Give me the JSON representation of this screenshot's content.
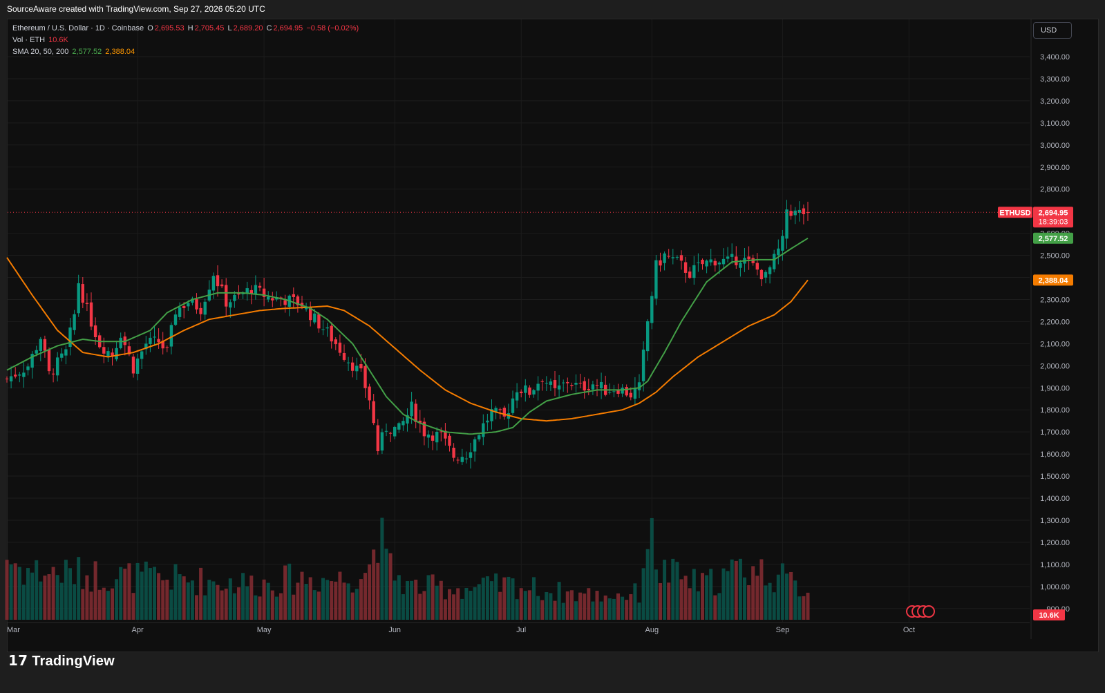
{
  "header": {
    "credit": "SourceAware created with TradingView.com, Sep 27, 2026 05:20 UTC"
  },
  "legend": {
    "symbol": "Ethereum / U.S. Dollar · 1D · Coinbase",
    "o_label": "O",
    "o_value": "2,695.53",
    "h_label": "H",
    "h_value": "2,705.45",
    "l_label": "L",
    "l_value": "2,689.20",
    "c_label": "C",
    "c_value": "2,694.95",
    "change": "−0.58 (−0.02%)",
    "vol_label": "Vol · ETH",
    "vol_value": "10.6K",
    "sma_label": "SMA 20, 50, 200",
    "sma20_value": "2,577.52",
    "sma50_value": "2,388.04"
  },
  "currency_button": "USD",
  "brand": "TradingView",
  "colors": {
    "up": "#089981",
    "down": "#f23645",
    "sma20": "#43a047",
    "sma50": "#f57c00",
    "background": "#0f0f0f",
    "grid": "#1c1c1c",
    "text": "#b2b5be"
  },
  "chart_data": {
    "type": "candlestick",
    "title": "Ethereum / U.S. Dollar · 1D · Coinbase",
    "ylim": [
      900,
      3500
    ],
    "y_ticks": [
      3400,
      3300,
      3200,
      3100,
      3000,
      2900,
      2800,
      2600,
      2500,
      2400,
      2300,
      2200,
      2100,
      2000,
      1900,
      1800,
      1700,
      1600,
      1500,
      1400,
      1300,
      1200,
      1100,
      1000,
      900
    ],
    "y_tick_labels": [
      "3,400.00",
      "3,300.00",
      "3,200.00",
      "3,100.00",
      "3,000.00",
      "2,900.00",
      "2,800.00",
      "2,600.00",
      "2,500.00",
      "2,400.00",
      "2,300.00",
      "2,200.00",
      "2,100.00",
      "2,000.00",
      "1,900.00",
      "1,800.00",
      "1,700.00",
      "1,600.00",
      "1,500.00",
      "1,400.00",
      "1,300.00",
      "1,200.00",
      "1,100.00",
      "1,000.00",
      "900.00"
    ],
    "x_ticks": [
      "Mar",
      "Apr",
      "May",
      "Jun",
      "Jul",
      "Aug",
      "Sep",
      "Oct"
    ],
    "x_tick_days": [
      0,
      31,
      61,
      92,
      122,
      153,
      184,
      214
    ],
    "close_keypoints": [
      [
        0,
        1940
      ],
      [
        5,
        2000
      ],
      [
        8,
        2130
      ],
      [
        10,
        1960
      ],
      [
        14,
        2060
      ],
      [
        16,
        2230
      ],
      [
        17,
        2380
      ],
      [
        19,
        2250
      ],
      [
        22,
        2100
      ],
      [
        25,
        2050
      ],
      [
        27,
        2150
      ],
      [
        30,
        1990
      ],
      [
        33,
        2100
      ],
      [
        36,
        2110
      ],
      [
        38,
        2060
      ],
      [
        40,
        2250
      ],
      [
        43,
        2290
      ],
      [
        46,
        2260
      ],
      [
        49,
        2420
      ],
      [
        52,
        2290
      ],
      [
        55,
        2310
      ],
      [
        58,
        2350
      ],
      [
        62,
        2310
      ],
      [
        66,
        2300
      ],
      [
        70,
        2280
      ],
      [
        73,
        2210
      ],
      [
        76,
        2150
      ],
      [
        80,
        2050
      ],
      [
        84,
        1960
      ],
      [
        86,
        1850
      ],
      [
        88,
        1620
      ],
      [
        90,
        1720
      ],
      [
        93,
        1710
      ],
      [
        96,
        1810
      ],
      [
        99,
        1700
      ],
      [
        103,
        1680
      ],
      [
        106,
        1590
      ],
      [
        109,
        1600
      ],
      [
        112,
        1700
      ],
      [
        115,
        1790
      ],
      [
        118,
        1760
      ],
      [
        121,
        1900
      ],
      [
        124,
        1880
      ],
      [
        127,
        1950
      ],
      [
        130,
        1880
      ],
      [
        133,
        1930
      ],
      [
        136,
        1900
      ],
      [
        139,
        1920
      ],
      [
        142,
        1890
      ],
      [
        145,
        1900
      ],
      [
        148,
        1870
      ],
      [
        150,
        1900
      ],
      [
        152,
        2200
      ],
      [
        154,
        2450
      ],
      [
        156,
        2500
      ],
      [
        159,
        2470
      ],
      [
        162,
        2420
      ],
      [
        165,
        2460
      ],
      [
        168,
        2480
      ],
      [
        171,
        2470
      ],
      [
        174,
        2490
      ],
      [
        177,
        2450
      ],
      [
        180,
        2400
      ],
      [
        182,
        2480
      ],
      [
        184,
        2560
      ],
      [
        185,
        2710
      ],
      [
        187,
        2690
      ],
      [
        190,
        2694.95
      ]
    ],
    "sma20_points": [
      [
        0,
        1980
      ],
      [
        6,
        2040
      ],
      [
        12,
        2090
      ],
      [
        18,
        2120
      ],
      [
        22,
        2110
      ],
      [
        28,
        2110
      ],
      [
        34,
        2160
      ],
      [
        38,
        2240
      ],
      [
        44,
        2300
      ],
      [
        50,
        2330
      ],
      [
        56,
        2330
      ],
      [
        61,
        2320
      ],
      [
        66,
        2300
      ],
      [
        72,
        2260
      ],
      [
        76,
        2210
      ],
      [
        82,
        2100
      ],
      [
        86,
        1980
      ],
      [
        90,
        1860
      ],
      [
        94,
        1780
      ],
      [
        98,
        1740
      ],
      [
        104,
        1700
      ],
      [
        110,
        1690
      ],
      [
        116,
        1700
      ],
      [
        120,
        1720
      ],
      [
        124,
        1790
      ],
      [
        128,
        1840
      ],
      [
        134,
        1870
      ],
      [
        140,
        1890
      ],
      [
        146,
        1890
      ],
      [
        150,
        1900
      ],
      [
        152,
        1930
      ],
      [
        156,
        2060
      ],
      [
        160,
        2200
      ],
      [
        166,
        2380
      ],
      [
        172,
        2470
      ],
      [
        178,
        2480
      ],
      [
        182,
        2480
      ],
      [
        186,
        2530
      ],
      [
        190,
        2577.52
      ]
    ],
    "sma50_points": [
      [
        0,
        2490
      ],
      [
        6,
        2320
      ],
      [
        12,
        2160
      ],
      [
        18,
        2060
      ],
      [
        24,
        2040
      ],
      [
        30,
        2060
      ],
      [
        36,
        2100
      ],
      [
        42,
        2160
      ],
      [
        48,
        2210
      ],
      [
        54,
        2230
      ],
      [
        60,
        2250
      ],
      [
        66,
        2260
      ],
      [
        72,
        2265
      ],
      [
        76,
        2270
      ],
      [
        80,
        2250
      ],
      [
        86,
        2180
      ],
      [
        92,
        2080
      ],
      [
        98,
        1980
      ],
      [
        104,
        1890
      ],
      [
        110,
        1830
      ],
      [
        116,
        1790
      ],
      [
        122,
        1760
      ],
      [
        128,
        1750
      ],
      [
        134,
        1760
      ],
      [
        140,
        1780
      ],
      [
        146,
        1800
      ],
      [
        150,
        1830
      ],
      [
        154,
        1880
      ],
      [
        158,
        1950
      ],
      [
        164,
        2040
      ],
      [
        170,
        2110
      ],
      [
        176,
        2180
      ],
      [
        182,
        2230
      ],
      [
        186,
        2290
      ],
      [
        190,
        2388.04
      ]
    ],
    "volume_keypoints": [
      [
        0,
        9000
      ],
      [
        4,
        7200
      ],
      [
        10,
        6800
      ],
      [
        20,
        6500
      ],
      [
        35,
        6000
      ],
      [
        50,
        5500
      ],
      [
        60,
        5200
      ],
      [
        70,
        6000
      ],
      [
        80,
        5800
      ],
      [
        86,
        7500
      ],
      [
        88,
        13500
      ],
      [
        90,
        8000
      ],
      [
        95,
        4800
      ],
      [
        110,
        4500
      ],
      [
        120,
        5000
      ],
      [
        130,
        4000
      ],
      [
        140,
        3500
      ],
      [
        150,
        3800
      ],
      [
        152,
        13000
      ],
      [
        155,
        7000
      ],
      [
        165,
        5000
      ],
      [
        175,
        7500
      ],
      [
        182,
        6500
      ],
      [
        185,
        5500
      ],
      [
        190,
        4200
      ]
    ],
    "last_price": 2694.95,
    "last_price_label": "2,694.95",
    "countdown": "18:39:03",
    "symbol_tag": "ETHUSD",
    "sma20_label": "2,577.52",
    "sma50_label": "2,388.04",
    "volume_label": "10.6K"
  }
}
